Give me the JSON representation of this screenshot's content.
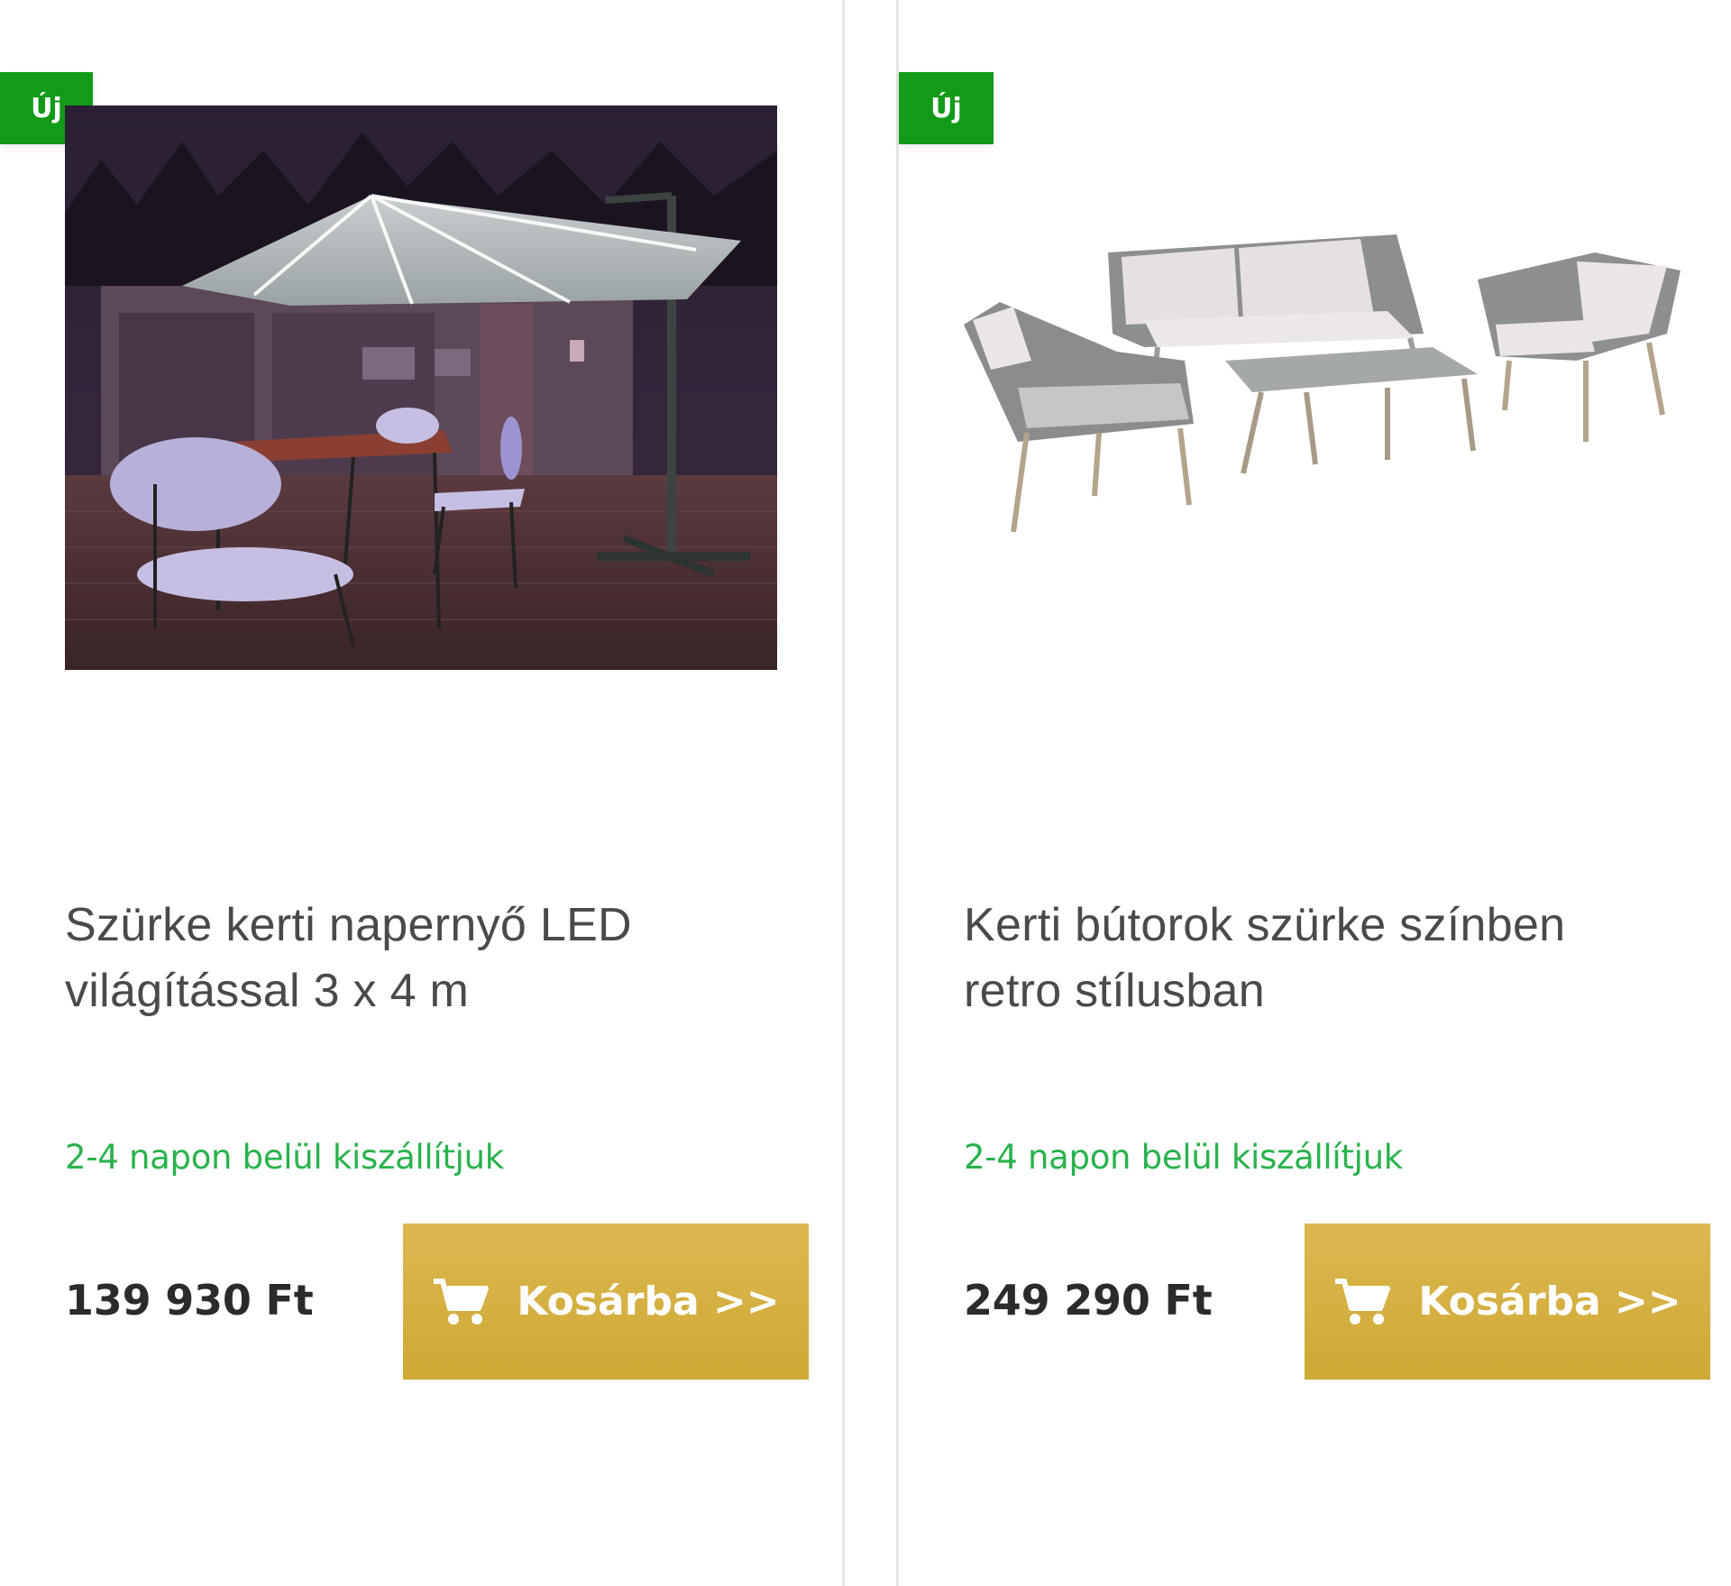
{
  "colors": {
    "badge_bg": "#129a18",
    "delivery_text": "#2ab24d",
    "cart_button_bg": "#d4ae3f",
    "price_text": "#2b2b2b",
    "title_text": "#4a4a4a"
  },
  "products": [
    {
      "badge": "Új",
      "image_icon": "patio-umbrella-led-photo",
      "title": "Szürke kerti napernyő LED világítással 3 x 4 m",
      "delivery": "2-4 napon belül kiszállítjuk",
      "price": "139 930 Ft",
      "button": {
        "icon": "cart-icon",
        "label": "Kosárba >>"
      }
    },
    {
      "badge": "Új",
      "image_icon": "garden-furniture-set-photo",
      "title": "Kerti bútorok szürke színben retro stílusban",
      "delivery": "2-4 napon belül kiszállítjuk",
      "price": "249 290 Ft",
      "button": {
        "icon": "cart-icon",
        "label": "Kosárba >>"
      }
    }
  ]
}
